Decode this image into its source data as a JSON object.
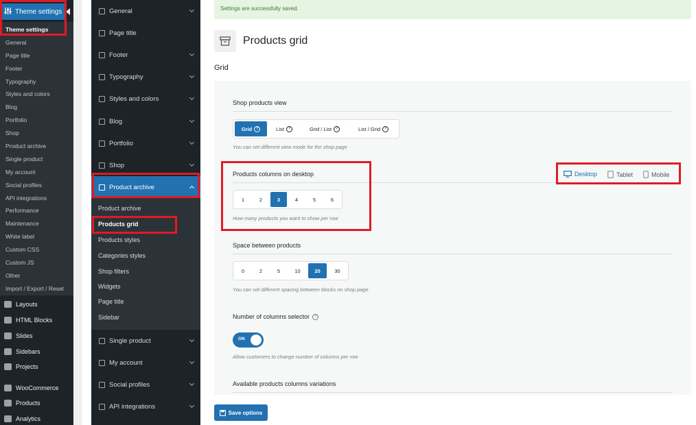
{
  "wp_menu": {
    "head_label": "Theme settings",
    "submenu": [
      "Theme settings",
      "General",
      "Page title",
      "Footer",
      "Typography",
      "Styles and colors",
      "Blog",
      "Portfolio",
      "Shop",
      "Product archive",
      "Single product",
      "My account",
      "Social profiles",
      "API integrations",
      "Performance",
      "Maintenance",
      "White label",
      "Custom CSS",
      "Custom JS",
      "Other",
      "Import / Export / Reset"
    ],
    "main_items": [
      "Layouts",
      "HTML Blocks",
      "Slides",
      "Sidebars",
      "Projects",
      "WooCommerce",
      "Products",
      "Analytics"
    ]
  },
  "options_nav": {
    "items": [
      "General",
      "Page title",
      "Footer",
      "Typography",
      "Styles and colors",
      "Blog",
      "Portfolio",
      "Shop",
      "Product archive"
    ],
    "sub_items": [
      "Product archive",
      "Products grid",
      "Products styles",
      "Categories styles",
      "Shop filters",
      "Widgets",
      "Page title",
      "Sidebar"
    ],
    "items_after": [
      "Single product",
      "My account",
      "Social profiles",
      "API integrations"
    ]
  },
  "notice": "Settings are successfully saved.",
  "page": {
    "title": "Products grid",
    "section": "Grid"
  },
  "fields": {
    "shop_view": {
      "label": "Shop products view",
      "options": [
        "Grid",
        "List",
        "Grid / List",
        "List / Grid"
      ],
      "selected": "Grid",
      "hint": "You can set different view mode for the shop page"
    },
    "columns_desktop": {
      "label": "Products columns on desktop",
      "options": [
        "1",
        "2",
        "3",
        "4",
        "5",
        "6"
      ],
      "selected": "3",
      "hint": "How many products you want to show per row"
    },
    "devices": [
      "Desktop",
      "Tablet",
      "Mobile"
    ],
    "space": {
      "label": "Space between products",
      "options": [
        "0",
        "2",
        "5",
        "10",
        "20",
        "30"
      ],
      "selected": "20",
      "hint": "You can set different spacing between blocks on shop page"
    },
    "columns_selector": {
      "label": "Number of columns selector",
      "toggle": "ON",
      "hint": "Allow customers to change number of columns per row"
    },
    "variations": {
      "label": "Available products columns variations"
    }
  },
  "save_label": "Save options",
  "colors": {
    "accent": "#2271b1",
    "highlight": "#e01b24",
    "menu_bg": "#1d2327"
  }
}
